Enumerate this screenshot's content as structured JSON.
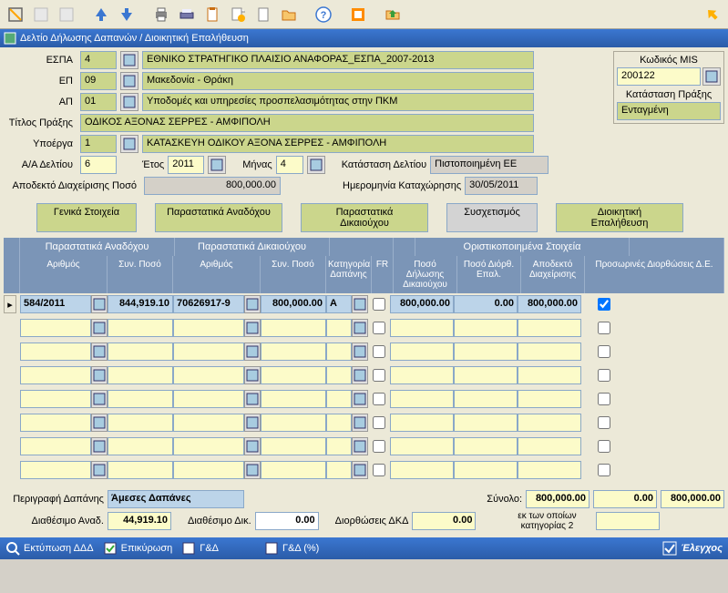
{
  "window_title": "Δελτίο Δήλωσης Δαπανών / Διοικητική Επαλήθευση",
  "header": {
    "espa_label": "ΕΣΠΑ",
    "espa_code": "4",
    "espa_desc": "ΕΘΝΙΚΟ ΣΤΡΑΤΗΓΙΚΟ ΠΛΑΙΣΙΟ ΑΝΑΦΟΡΑΣ_ΕΣΠΑ_2007-2013",
    "ep_label": "ΕΠ",
    "ep_code": "09",
    "ep_desc": "Μακεδονία - Θράκη",
    "ap_label": "ΑΠ",
    "ap_code": "01",
    "ap_desc": "Υποδομές και υπηρεσίες προσπελασιμότητας στην ΠΚΜ",
    "title_label": "Τίτλος Πράξης",
    "title_val": "ΟΔΙΚΟΣ ΑΞΟΝΑΣ ΣΕΡΡΕΣ - ΑΜΦΙΠΟΛΗ",
    "ypoerga_label": "Υποέργα",
    "ypoerga_code": "1",
    "ypoerga_desc": "ΚΑΤΑΣΚΕΥΗ ΟΔΙΚΟΥ ΑΞΟΝΑ ΣΕΡΡΕΣ - ΑΜΦΙΠΟΛΗ",
    "aa_label": "Α/Α Δελτίου",
    "aa_val": "6",
    "year_label": "Έτος",
    "year_val": "2011",
    "month_label": "Μήνας",
    "month_val": "4",
    "status_label": "Κατάσταση Δελτίου",
    "status_val": "Πιστοποιημένη ΕΕ",
    "accepted_label": "Αποδεκτό Διαχείρισης Ποσό",
    "accepted_val": "800,000.00",
    "regdate_label": "Ημερομηνία Καταχώρησης",
    "regdate_val": "30/05/2011"
  },
  "mis": {
    "label": "Κωδικός MIS",
    "code": "200122",
    "state_label": "Κατάσταση Πράξης",
    "state_val": "Ενταγμένη"
  },
  "tabs": {
    "t1": "Γενικά Στοιχεία",
    "t2": "Παραστατικά Αναδόχου",
    "t3": "Παραστατικά Δικαιούχου",
    "t4": "Συσχετισμός",
    "t5": "Διοικητική Επαλήθευση"
  },
  "grid": {
    "group1": "Παραστατικά Αναδόχου",
    "group2": "Παραστατικά Δικαιούχου",
    "group_cat": "Κατηγορία Δαπάνης",
    "group_fr": "FR",
    "group3": "Οριστικοποιημένα Στοιχεία",
    "col_num": "Αριθμός",
    "col_synposo": "Συν. Ποσό",
    "col_posodil": "Ποσό Δήλωσης Δικαιούχου",
    "col_posodio": "Ποσό Διόρθ. Επαλ.",
    "col_apod": "Αποδεκτό Διαχείρισης",
    "col_pros": "Προσωρινές Διορθώσεις Δ.Ε.",
    "row": {
      "num1": "584/2011",
      "amt1": "844,919.10",
      "num2": "70626917-9",
      "amt2": "800,000.00",
      "cat": "A",
      "dik": "800,000.00",
      "epal": "0.00",
      "apod": "800,000.00"
    }
  },
  "bottom": {
    "descr_label": "Περιγραφή Δαπάνης",
    "descr_val": "Άμεσες Δαπάνες",
    "avail_anad_label": "Διαθέσιμο Αναδ.",
    "avail_anad_val": "44,919.10",
    "avail_dik_label": "Διαθέσιμο Δικ.",
    "avail_dik_val": "0.00",
    "synolo_label": "Σύνολο:",
    "synolo_v1": "800,000.00",
    "synolo_v2": "0.00",
    "synolo_v3": "800,000.00",
    "diorth_label": "Διορθώσεις ΔΚΔ",
    "diorth_val": "0.00",
    "ek_label": "εκ των οποίων κατηγορίας 2"
  },
  "footer": {
    "print": "Εκτύπωση ΔΔΔ",
    "validate": "Επικύρωση",
    "gd": "Γ&Δ",
    "gdp": "Γ&Δ (%)",
    "check": "Έλεγχος"
  }
}
